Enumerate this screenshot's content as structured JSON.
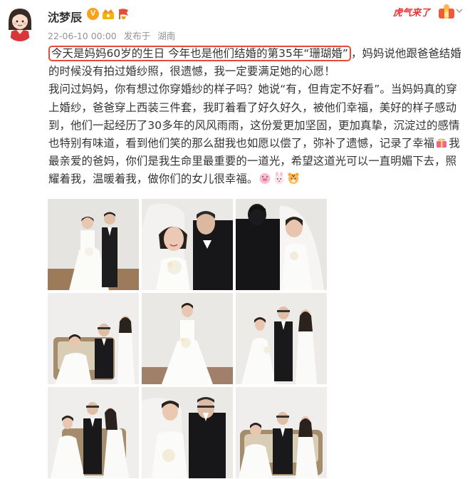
{
  "post": {
    "username": "沈梦辰",
    "verified_badge": "V",
    "timestamp": "22-06-10 00:00",
    "location_prefix": "发布于",
    "location": "湖南",
    "corner_text": "虎气来了"
  },
  "content": {
    "highlight": "今天是妈妈60岁的生日 今年也是他们结婚的第35年“珊瑚婚”",
    "line1_rest": "，妈妈说他跟爸爸结婚的时候没有拍过婚纱照，很遗憾，我一定要满足她的心愿！",
    "para2_a": "我问过妈妈，你有想过你穿婚纱的样子吗？她说“有，但肯定不好看”。当妈妈真的穿上婚纱，爸爸穿上西装三件套，我盯着看了好久好久，被他们幸福，美好的样子感动到，他们一起经历了30多年的风风雨雨，这份爱更加坚固，更加真挚，沉淀过的感情也特别有味道，看到他们笑的那么甜我也如愿以偿了，弥补了遗憾，记录了幸福",
    "para2_b": "我最亲爱的爸妈，你们是我生命里最重要的一道光，希望这道光可以一直明媚下去，照耀着我，温暖着我，做你们的女儿很幸福。"
  },
  "icons": {
    "avatar": "avatar-girl-icon",
    "crown": "crown-icon",
    "flag": "flag-icon",
    "cake": "cake-icon",
    "gift": "gift-icon",
    "pig": "pig-face-icon",
    "rabbit": "rabbit-face-icon",
    "tiger": "tiger-face-icon"
  },
  "colors": {
    "highlight_border": "#e64a3a",
    "meta_text": "#939393",
    "verified": "#f7a21b"
  },
  "photos": [
    {
      "scene": "couple-standing"
    },
    {
      "scene": "couple-closeup"
    },
    {
      "scene": "groom-back-bride-veil"
    },
    {
      "scene": "family-seated"
    },
    {
      "scene": "bride-alone"
    },
    {
      "scene": "family-standing"
    },
    {
      "scene": "family-kiss"
    },
    {
      "scene": "couple-smile"
    },
    {
      "scene": "family-seated-2"
    }
  ]
}
